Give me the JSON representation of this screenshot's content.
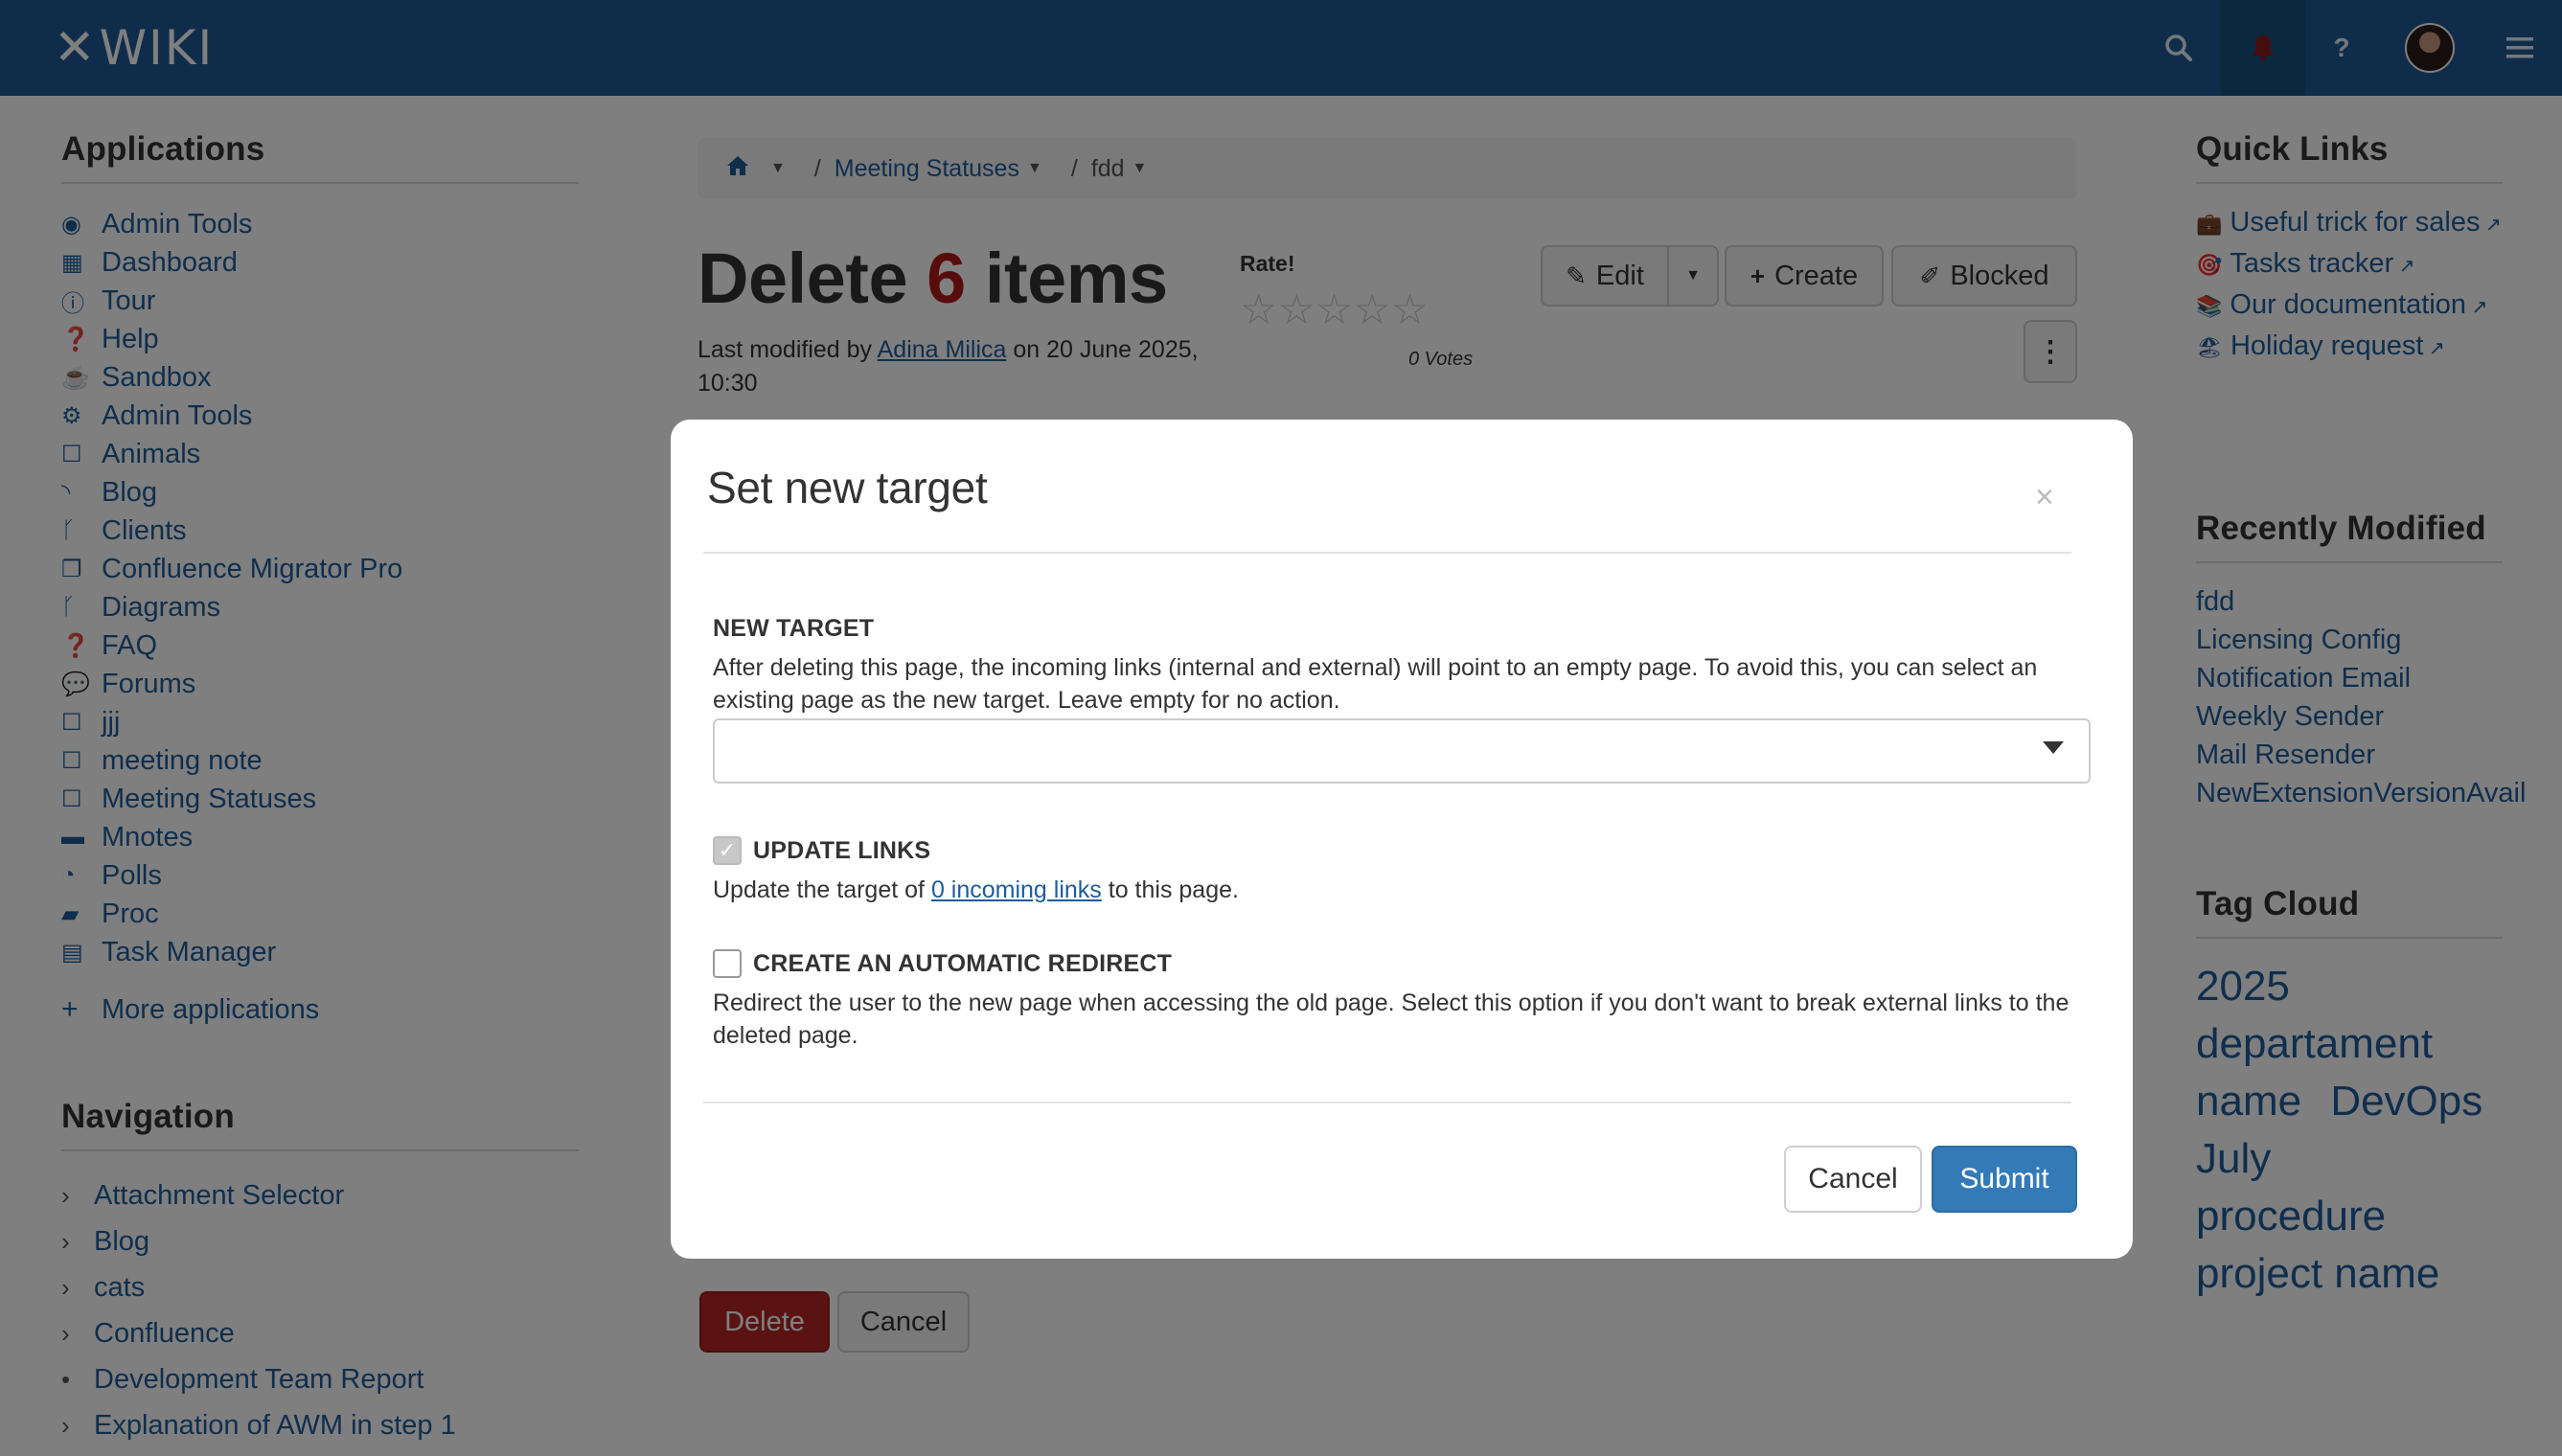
{
  "topbar": {
    "logo_text": "WIKI",
    "logo_mark": "✕",
    "icons": [
      "search-icon",
      "bell-icon",
      "question-icon",
      "avatar",
      "hamburger-icon"
    ]
  },
  "applications": {
    "title": "Applications",
    "items": [
      {
        "label": "Admin Tools",
        "icon": "globe-icon",
        "glyph": "◉"
      },
      {
        "label": "Dashboard",
        "icon": "dashboard-icon",
        "glyph": "▦"
      },
      {
        "label": "Tour",
        "icon": "info-icon",
        "glyph": "ⓘ"
      },
      {
        "label": "Help",
        "icon": "help-icon",
        "glyph": "❓"
      },
      {
        "label": "Sandbox",
        "icon": "cup-icon",
        "glyph": "☕"
      },
      {
        "label": "Admin Tools",
        "icon": "gear-icon",
        "glyph": "⚙"
      },
      {
        "label": "Animals",
        "icon": "square-icon",
        "glyph": "☐"
      },
      {
        "label": "Blog",
        "icon": "rss-icon",
        "glyph": "◝"
      },
      {
        "label": "Clients",
        "icon": "branch-icon",
        "glyph": "ᚴ"
      },
      {
        "label": "Confluence Migrator Pro",
        "icon": "copy-icon",
        "glyph": "❐"
      },
      {
        "label": "Diagrams",
        "icon": "branch-icon",
        "glyph": "ᚴ"
      },
      {
        "label": "FAQ",
        "icon": "question-circle-icon",
        "glyph": "❓"
      },
      {
        "label": "Forums",
        "icon": "comments-icon",
        "glyph": "💬"
      },
      {
        "label": "jjj",
        "icon": "square-icon",
        "glyph": "☐"
      },
      {
        "label": "meeting note",
        "icon": "square-icon",
        "glyph": "☐"
      },
      {
        "label": "Meeting Statuses",
        "icon": "square-icon",
        "glyph": "☐"
      },
      {
        "label": "Mnotes",
        "icon": "briefcase-icon",
        "glyph": "▬"
      },
      {
        "label": "Polls",
        "icon": "pie-chart-icon",
        "glyph": "◔"
      },
      {
        "label": "Proc",
        "icon": "book-icon",
        "glyph": "▰"
      },
      {
        "label": "Task Manager",
        "icon": "list-icon",
        "glyph": "▤"
      }
    ],
    "more_label": "More applications"
  },
  "navigation": {
    "title": "Navigation",
    "items": [
      {
        "label": "Attachment Selector",
        "marker": "›"
      },
      {
        "label": "Blog",
        "marker": "›"
      },
      {
        "label": "cats",
        "marker": "›"
      },
      {
        "label": "Confluence",
        "marker": "›"
      },
      {
        "label": "Development Team Report",
        "marker": "•"
      },
      {
        "label": "Explanation of AWM in step 1",
        "marker": "›"
      }
    ]
  },
  "breadcrumb": {
    "items": [
      "Meeting Statuses",
      "fdd"
    ]
  },
  "page": {
    "title_prefix": "Delete",
    "count": "6",
    "title_suffix": "items",
    "modified_prefix": "Last modified by",
    "modified_author": "Adina Milica",
    "modified_suffix": "on 20 June 2025, 10:30",
    "rate_label": "Rate!",
    "votes": "0 Votes",
    "stars": "☆☆☆☆☆"
  },
  "actions": {
    "edit": "Edit",
    "create": "Create",
    "blocked": "Blocked",
    "delete": "Delete",
    "cancel": "Cancel"
  },
  "quick_links": {
    "title": "Quick Links",
    "items": [
      {
        "label": "Useful trick for sales",
        "emoji": "💼"
      },
      {
        "label": "Tasks tracker",
        "emoji": "🎯"
      },
      {
        "label": "Our documentation",
        "emoji": "📚"
      },
      {
        "label": "Holiday request",
        "emoji": "🏖"
      }
    ]
  },
  "recently_modified": {
    "title": "Recently Modified",
    "items": [
      "fdd",
      "Licensing Config",
      "Notification Email",
      "Weekly Sender",
      "Mail Resender",
      "NewExtensionVersionAvail"
    ]
  },
  "tag_cloud": {
    "title": "Tag Cloud",
    "tags": [
      "2025",
      "departament name",
      "DevOps",
      "July",
      "procedure",
      "project name"
    ]
  },
  "modal": {
    "title": "Set new target",
    "close": "×",
    "new_target_label": "NEW TARGET",
    "new_target_hint": "After deleting this page, the incoming links (internal and external) will point to an empty page. To avoid this, you can select an existing page as the new target. Leave empty for no action.",
    "update_links_label": "UPDATE LINKS",
    "update_links_checked": true,
    "update_links_hint_prefix": "Update the target of",
    "update_links_link": "0 incoming links",
    "update_links_hint_suffix": "to this page.",
    "redirect_label": "CREATE AN AUTOMATIC REDIRECT",
    "redirect_checked": false,
    "redirect_hint": "Redirect the user to the new page when accessing the old page. Select this option if you don't want to break external links to the deleted page.",
    "cancel": "Cancel",
    "submit": "Submit"
  },
  "colors": {
    "topbar": "#1f5a97",
    "link": "#1e5c9b",
    "danger": "#b01a1a",
    "primary": "#337ab7"
  }
}
